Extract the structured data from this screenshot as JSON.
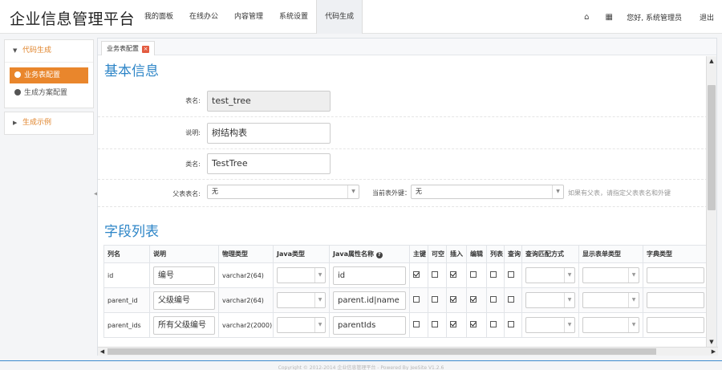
{
  "header": {
    "brand": "企业信息管理平台",
    "nav": [
      "我的面板",
      "在线办公",
      "内容管理",
      "系统设置",
      "代码生成"
    ],
    "home_icon": "home-icon",
    "apps_icon": "grid-icon",
    "greeting": "您好, 系统管理员",
    "logout": "退出"
  },
  "sidebar": {
    "group1": {
      "label": "代码生成",
      "items": [
        "业务表配置",
        "生成方案配置"
      ]
    },
    "group2": {
      "label": "生成示例"
    }
  },
  "tab": {
    "label": "业务表配置",
    "close": "×"
  },
  "basic": {
    "title": "基本信息",
    "table_name_label": "表名:",
    "table_name_value": "test_tree",
    "comment_label": "说明:",
    "comment_value": "树结构表",
    "class_label": "类名:",
    "class_value": "TestTree",
    "parent_label": "父表表名:",
    "parent_value": "无",
    "fk_label": "当前表外键：",
    "fk_value": "无",
    "fk_hint": "如果有父表，请指定父表表名和外键"
  },
  "fields": {
    "title": "字段列表",
    "headers": [
      "列名",
      "说明",
      "物理类型",
      "Java类型",
      "Java属性名称",
      "主键",
      "可空",
      "插入",
      "编辑",
      "列表",
      "查询",
      "查询匹配方式",
      "显示表单类型",
      "字典类型"
    ],
    "rows": [
      {
        "col": "id",
        "desc": "编号",
        "type": "varchar2(64)",
        "prop": "id",
        "checks": [
          true,
          false,
          true,
          false,
          false,
          false
        ]
      },
      {
        "col": "parent_id",
        "desc": "父级编号",
        "type": "varchar2(64)",
        "prop": "parent.id|name",
        "checks": [
          false,
          false,
          true,
          true,
          false,
          false
        ]
      },
      {
        "col": "parent_ids",
        "desc": "所有父级编号",
        "type": "varchar2(2000)",
        "prop": "parentIds",
        "checks": [
          false,
          false,
          true,
          true,
          false,
          false
        ]
      }
    ]
  },
  "footer": "Copyright © 2012-2014 企业信息管理平台 - Powered By JeeSite V1.2.6"
}
